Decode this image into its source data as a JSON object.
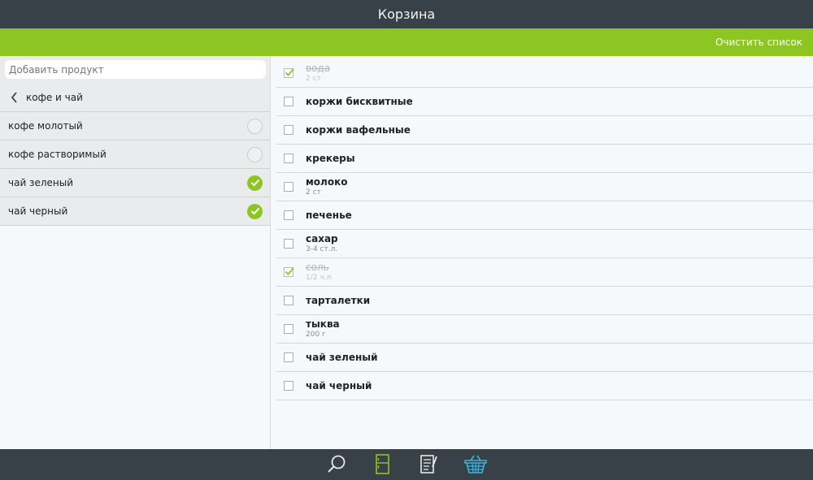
{
  "header": {
    "title": "Корзина"
  },
  "actionbar": {
    "clear_label": "Очистить список"
  },
  "sidebar": {
    "search_placeholder": "Добавить продукт",
    "category": "кофе и чай",
    "items": [
      {
        "label": "кофе молотый",
        "selected": false
      },
      {
        "label": "кофе растворимый",
        "selected": false
      },
      {
        "label": "чай зеленый",
        "selected": true
      },
      {
        "label": "чай черный",
        "selected": true
      }
    ]
  },
  "basket": {
    "items": [
      {
        "name": "вода",
        "qty": "2 ст",
        "checked": true
      },
      {
        "name": "коржи бисквитные",
        "qty": "",
        "checked": false
      },
      {
        "name": "коржи вафельные",
        "qty": "",
        "checked": false
      },
      {
        "name": "крекеры",
        "qty": "",
        "checked": false
      },
      {
        "name": "молоко",
        "qty": "2 ст",
        "checked": false
      },
      {
        "name": "печенье",
        "qty": "",
        "checked": false
      },
      {
        "name": "сахар",
        "qty": "3-4 ст.л.",
        "checked": false
      },
      {
        "name": "соль",
        "qty": "1/2 ч.л.",
        "checked": true
      },
      {
        "name": "тарталетки",
        "qty": "",
        "checked": false
      },
      {
        "name": "тыква",
        "qty": "200 г",
        "checked": false
      },
      {
        "name": "чай зеленый",
        "qty": "",
        "checked": false
      },
      {
        "name": "чай черный",
        "qty": "",
        "checked": false
      }
    ]
  },
  "bottom_nav": {
    "items": [
      {
        "icon": "search-icon"
      },
      {
        "icon": "fridge-icon",
        "active": true
      },
      {
        "icon": "recipe-list-icon"
      },
      {
        "icon": "basket-icon"
      }
    ]
  },
  "colors": {
    "accent": "#8dc523",
    "dark_bar": "#384048",
    "basket_icon": "#3ab3e6"
  }
}
